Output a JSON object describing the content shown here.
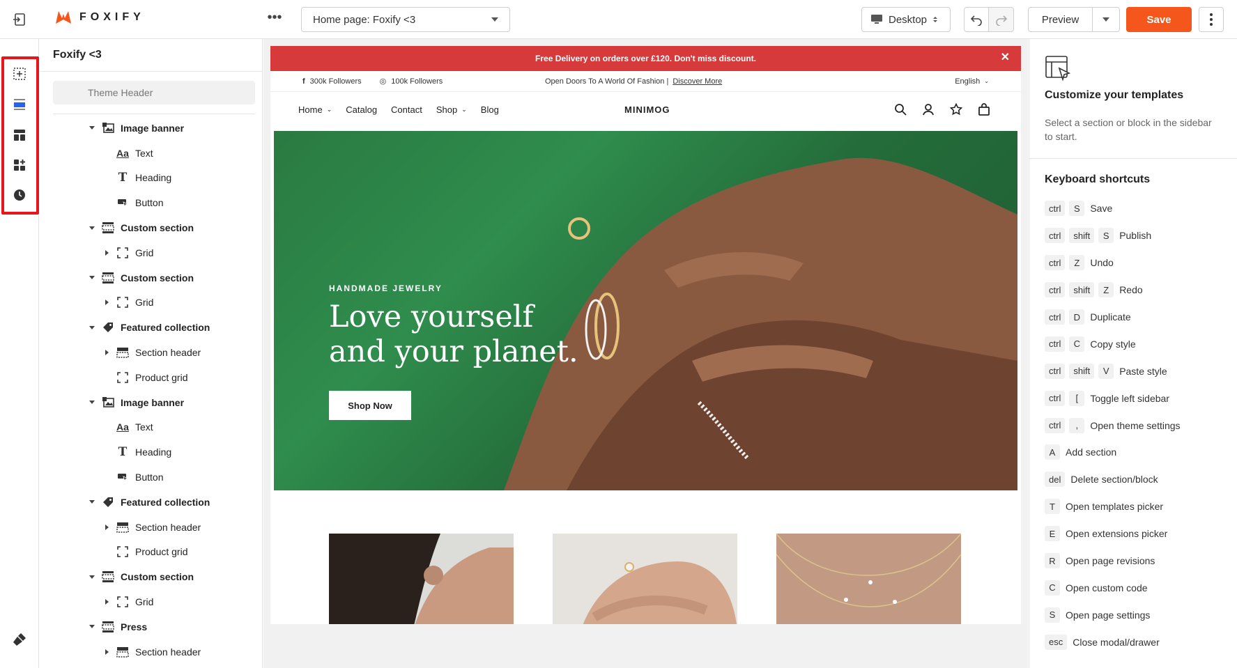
{
  "topbar": {
    "logo_text": "FOXIFY",
    "page_select": "Home page: Foxify <3",
    "device": "Desktop",
    "preview": "Preview",
    "save": "Save"
  },
  "sidebar": {
    "title": "Foxify <3",
    "theme_header": "Theme Header",
    "tree": [
      {
        "type": "section",
        "label": "Image banner",
        "icon": "image-banner-icon"
      },
      {
        "type": "block",
        "label": "Text",
        "icon": "text-icon"
      },
      {
        "type": "block",
        "label": "Heading",
        "icon": "heading-icon"
      },
      {
        "type": "block",
        "label": "Button",
        "icon": "button-icon"
      },
      {
        "type": "section",
        "label": "Custom section",
        "icon": "custom-section-icon"
      },
      {
        "type": "child",
        "label": "Grid",
        "icon": "grid-icon"
      },
      {
        "type": "section",
        "label": "Custom section",
        "icon": "custom-section-icon"
      },
      {
        "type": "child",
        "label": "Grid",
        "icon": "grid-icon"
      },
      {
        "type": "section",
        "label": "Featured collection",
        "icon": "tag-icon"
      },
      {
        "type": "child",
        "label": "Section header",
        "icon": "section-header-icon"
      },
      {
        "type": "block",
        "label": "Product grid",
        "icon": "grid-icon"
      },
      {
        "type": "section",
        "label": "Image banner",
        "icon": "image-banner-icon"
      },
      {
        "type": "block",
        "label": "Text",
        "icon": "text-icon"
      },
      {
        "type": "block",
        "label": "Heading",
        "icon": "heading-icon"
      },
      {
        "type": "block",
        "label": "Button",
        "icon": "button-icon"
      },
      {
        "type": "section",
        "label": "Featured collection",
        "icon": "tag-icon"
      },
      {
        "type": "child",
        "label": "Section header",
        "icon": "section-header-icon"
      },
      {
        "type": "block",
        "label": "Product grid",
        "icon": "grid-icon"
      },
      {
        "type": "section",
        "label": "Custom section",
        "icon": "custom-section-icon"
      },
      {
        "type": "child",
        "label": "Grid",
        "icon": "grid-icon"
      },
      {
        "type": "section",
        "label": "Press",
        "icon": "custom-section-icon"
      },
      {
        "type": "child",
        "label": "Section header",
        "icon": "section-header-icon"
      }
    ]
  },
  "preview_page": {
    "promo": "Free Delivery on orders over £120. Don't miss discount.",
    "facebook": "300k Followers",
    "instagram": "100k Followers",
    "util_text": "Open Doors To A World Of Fashion |",
    "util_link": "Discover More",
    "language": "English",
    "nav": [
      "Home",
      "Catalog",
      "Contact",
      "Shop",
      "Blog"
    ],
    "brand": "MINIMOG",
    "hero_eyebrow": "HANDMADE JEWELRY",
    "hero_title_1": "Love yourself",
    "hero_title_2": "and your planet.",
    "hero_button": "Shop Now"
  },
  "right_panel": {
    "title": "Customize your templates",
    "desc": "Select a section or block in the sidebar to start.",
    "kb_title": "Keyboard shortcuts",
    "shortcuts": [
      {
        "keys": [
          "ctrl",
          "S"
        ],
        "desc": "Save"
      },
      {
        "keys": [
          "ctrl",
          "shift",
          "S"
        ],
        "desc": "Publish"
      },
      {
        "keys": [
          "ctrl",
          "Z"
        ],
        "desc": "Undo"
      },
      {
        "keys": [
          "ctrl",
          "shift",
          "Z"
        ],
        "desc": "Redo"
      },
      {
        "keys": [
          "ctrl",
          "D"
        ],
        "desc": "Duplicate"
      },
      {
        "keys": [
          "ctrl",
          "C"
        ],
        "desc": "Copy style"
      },
      {
        "keys": [
          "ctrl",
          "shift",
          "V"
        ],
        "desc": "Paste style"
      },
      {
        "keys": [
          "ctrl",
          "["
        ],
        "desc": "Toggle left sidebar"
      },
      {
        "keys": [
          "ctrl",
          ","
        ],
        "desc": "Open theme settings"
      },
      {
        "keys": [
          "A"
        ],
        "desc": "Add section"
      },
      {
        "keys": [
          "del"
        ],
        "desc": "Delete section/block"
      },
      {
        "keys": [
          "T"
        ],
        "desc": "Open templates picker"
      },
      {
        "keys": [
          "E"
        ],
        "desc": "Open extensions picker"
      },
      {
        "keys": [
          "R"
        ],
        "desc": "Open page revisions"
      },
      {
        "keys": [
          "C"
        ],
        "desc": "Open custom code"
      },
      {
        "keys": [
          "S"
        ],
        "desc": "Open page settings"
      },
      {
        "keys": [
          "esc"
        ],
        "desc": "Close modal/drawer"
      }
    ]
  },
  "colors": {
    "accent": "#f5561b",
    "promo_bar": "#d63a3a",
    "highlight": "#e8161b"
  }
}
